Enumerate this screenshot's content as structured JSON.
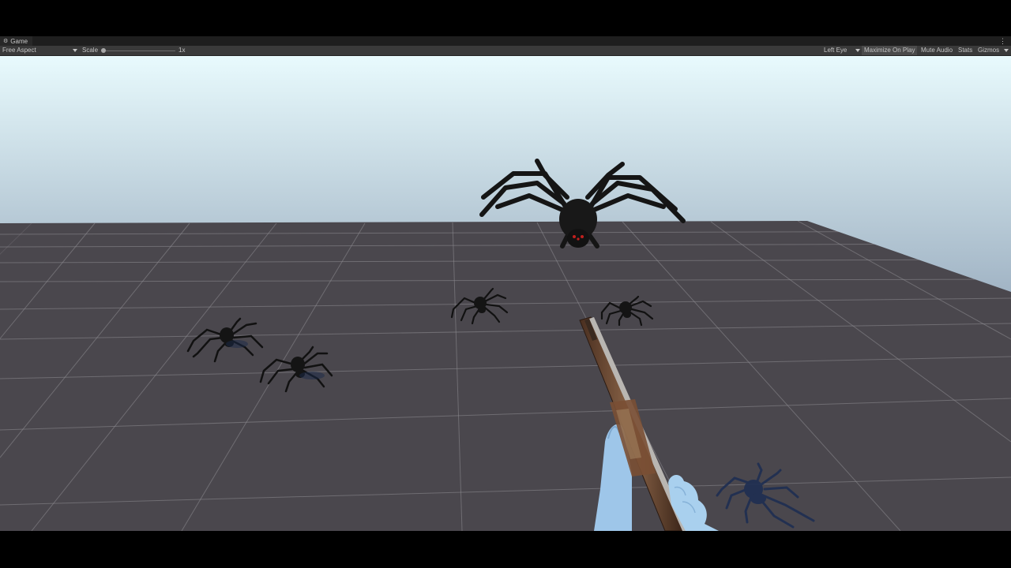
{
  "window": {
    "tab_label": "Game",
    "tab_icon": "gamepad-icon"
  },
  "toolbar": {
    "aspect_label": "Free Aspect",
    "scale_label": "Scale",
    "scale_value": "1x",
    "eye_label": "Left Eye",
    "maximize_label": "Maximize On Play",
    "mute_label": "Mute Audio",
    "stats_label": "Stats",
    "gizmos_label": "Gizmos"
  },
  "scene": {
    "sky_top_color": "#e8fafd",
    "sky_bottom_color": "#9fb2c3",
    "floor_color": "#4a474d",
    "grid_color": "#8e8c92",
    "spider_color": "#171717",
    "spider_eye_color": "#c0201e",
    "hand_color": "#9ec6e9",
    "gun_color": "#6a4a35"
  }
}
